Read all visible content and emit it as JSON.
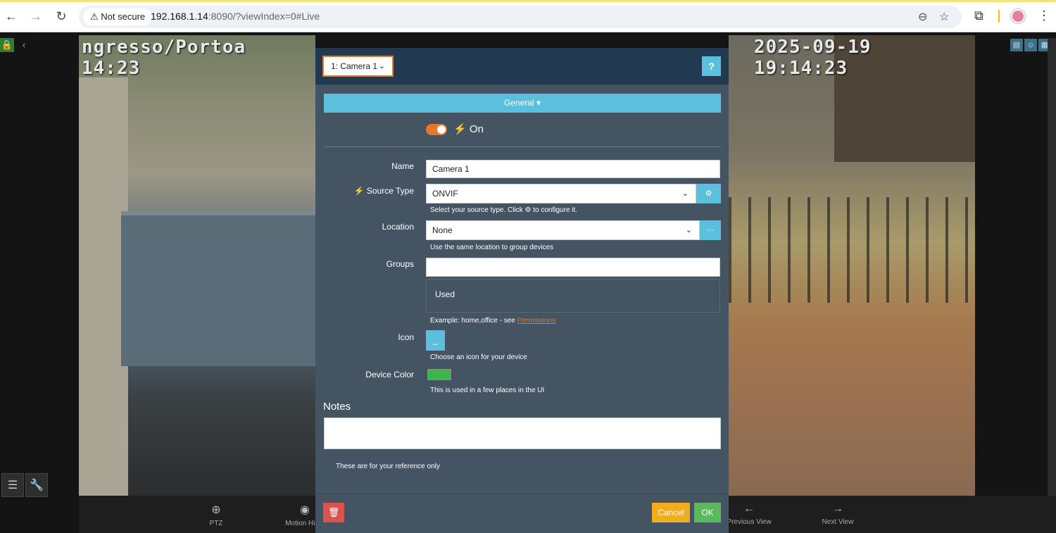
{
  "browser": {
    "back_icon": "←",
    "forward_icon": "→",
    "reload_icon": "↻",
    "security_label": "Not secure",
    "warning_icon": "⚠",
    "url_host": "192.168.1.14",
    "url_rest": ":8090/?viewIndex=0#Live",
    "zoom_icon": "⊖",
    "star_icon": "☆",
    "extensions_icon": "⧉",
    "menu_icon": "⋮"
  },
  "camera": {
    "timestamp_left": "ngresso/Portoa 14:23",
    "timestamp_right": "2025-09-19 19:14:23"
  },
  "sidebar": {
    "lock_icon": "🔒",
    "collapse_icon": "‹",
    "settings_icon": "☰",
    "tools_icon": "🔧"
  },
  "bottom_bar": {
    "items": [
      {
        "label": "PTZ",
        "icon": "⊕"
      },
      {
        "label": "Motion Highl",
        "icon": "◉"
      },
      {
        "label": "Previous View",
        "icon": "←"
      },
      {
        "label": "Next View",
        "icon": "→"
      }
    ]
  },
  "modal": {
    "camera_select": "1: Camera 1",
    "chevron": "⌄",
    "help_label": "?",
    "section_label": "General ▾",
    "toggle_bolt": "⚡",
    "toggle_label": "On",
    "fields": {
      "name_label": "Name",
      "name_value": "Camera 1",
      "source_type_label": "Source Type",
      "source_type_value": "ONVIF",
      "source_type_hint_pre": "Select your source type. Click",
      "source_type_hint_post": "to configure it.",
      "gear_icon": "⚙",
      "location_label": "Location",
      "location_value": "None",
      "location_addon": "···",
      "location_hint": "Use the same location to group devices",
      "groups_label": "Groups",
      "groups_value": "",
      "groups_used": "Used",
      "groups_hint_pre": "Example: home,office - see",
      "groups_hint_link": "Permissions",
      "icon_label": "Icon",
      "icon_button": "_",
      "icon_hint": "Choose an icon for your device",
      "device_color_label": "Device Color",
      "device_color_value": "#3cb54a",
      "device_color_hint": "This is used in a few places in the UI"
    },
    "notes_title": "Notes",
    "notes_value": "",
    "notes_hint": "These are for your reference only",
    "delete_icon": "🗑",
    "cancel_label": "Cancel",
    "ok_label": "OK"
  }
}
